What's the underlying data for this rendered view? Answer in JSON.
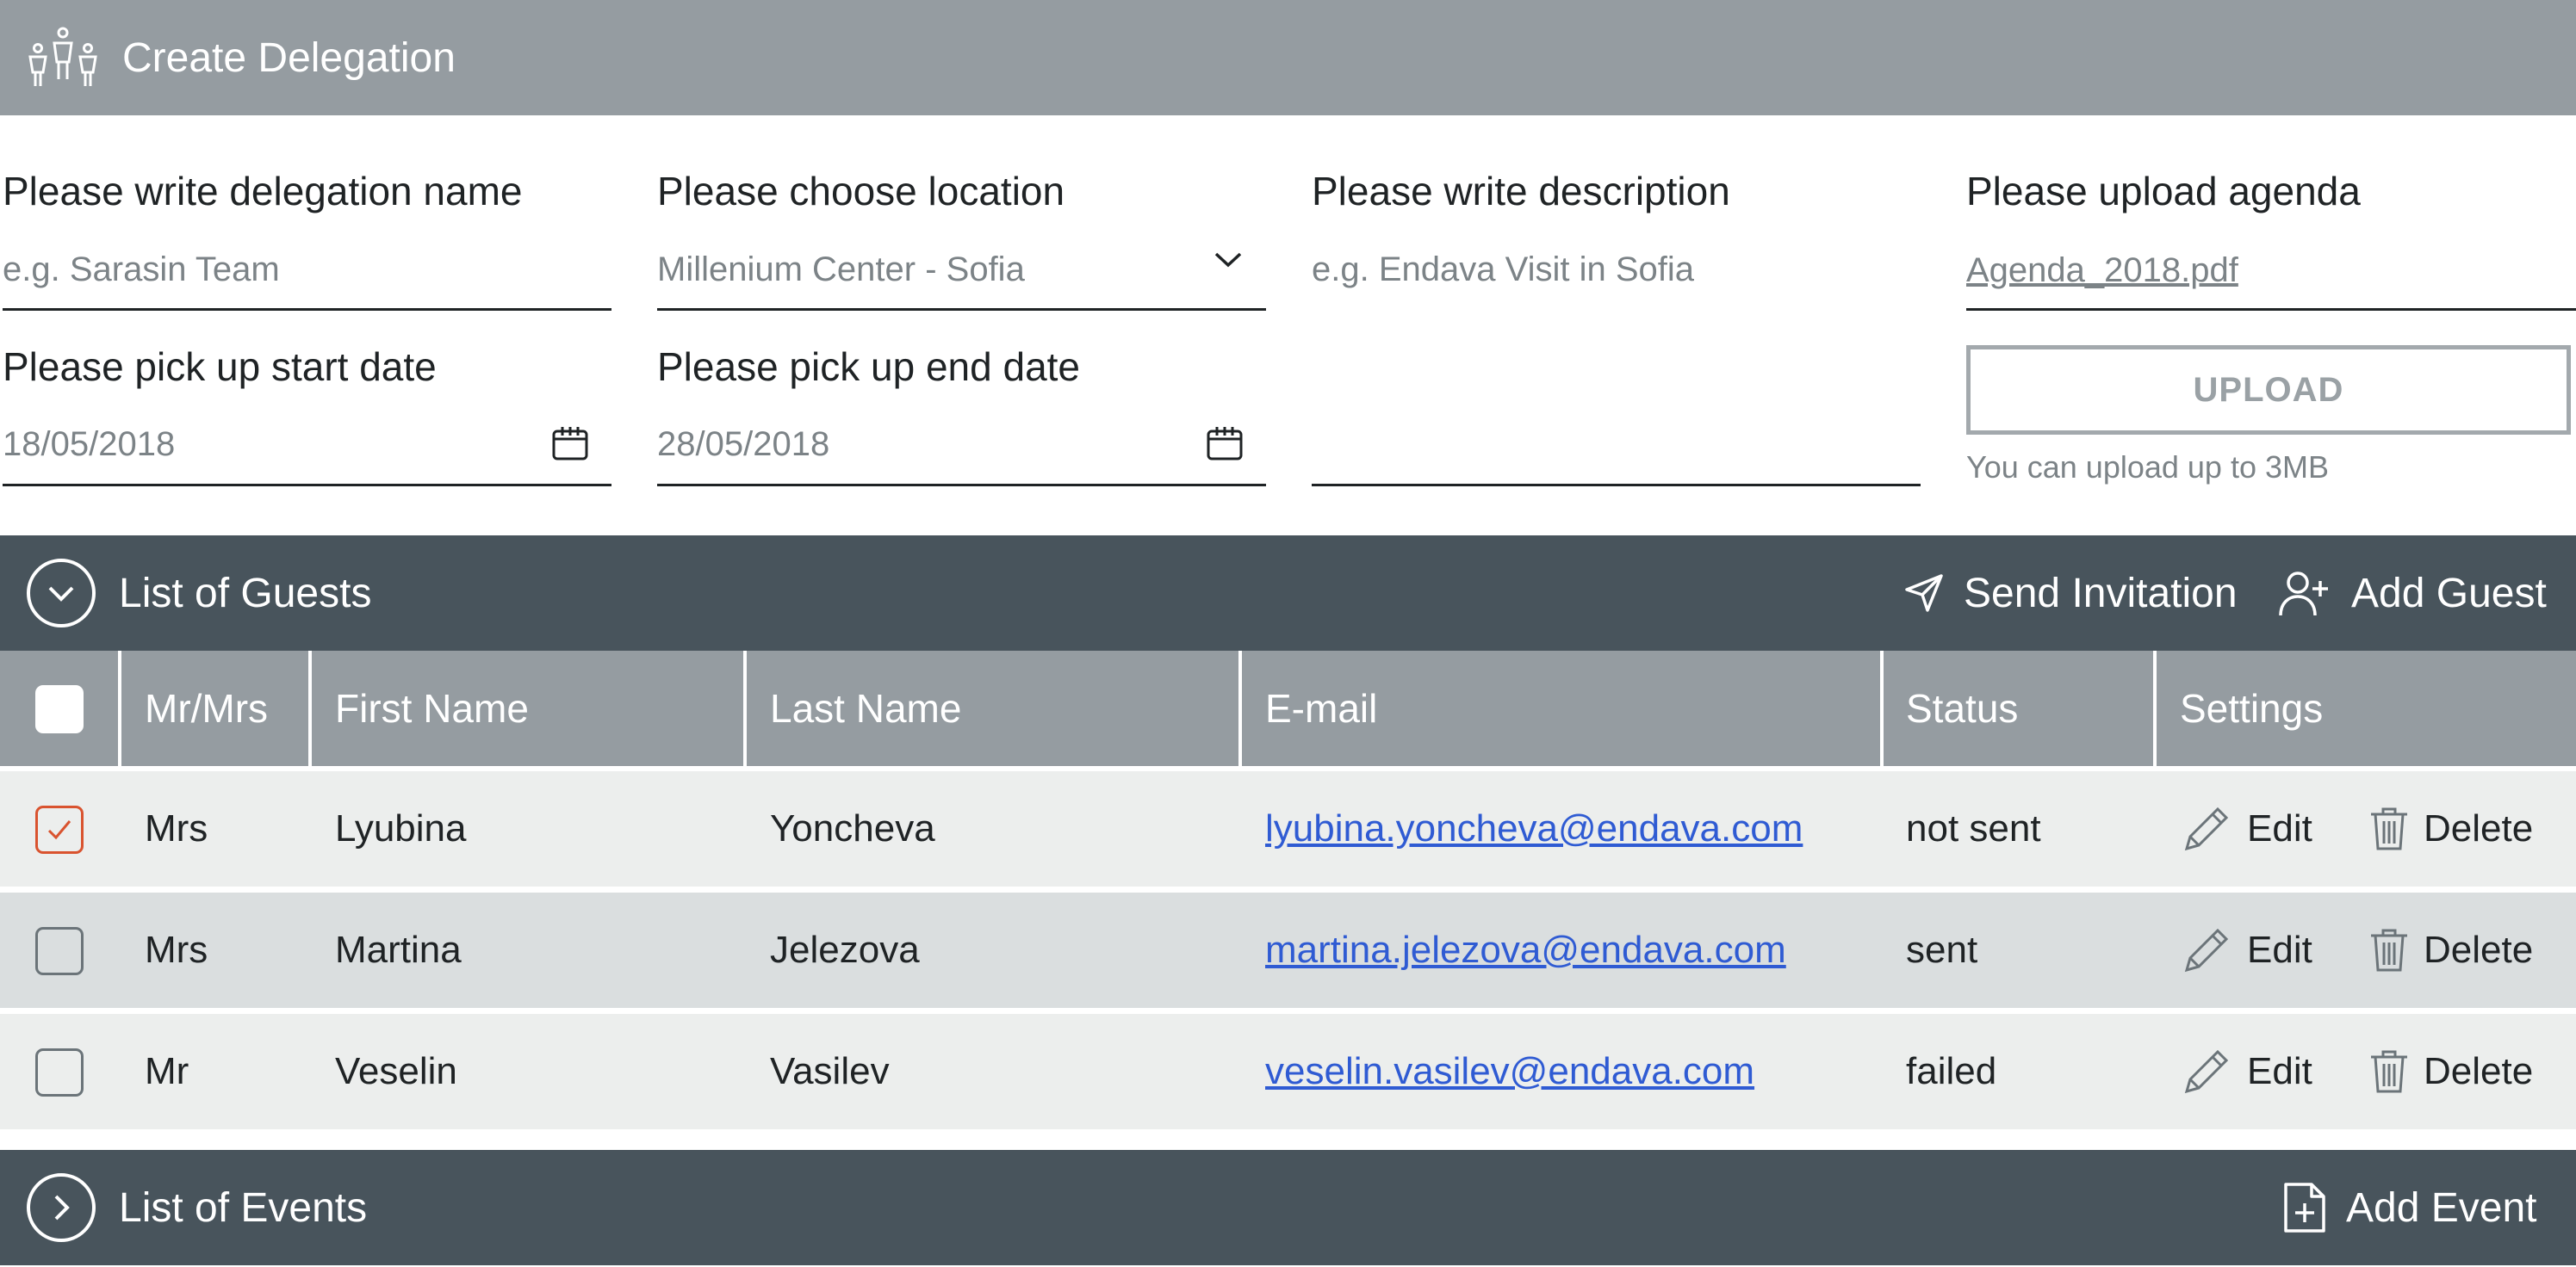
{
  "header": {
    "title": "Create Delegation",
    "icon": "delegation-people-icon"
  },
  "form": {
    "name": {
      "label": "Please write delegation name",
      "placeholder": "e.g. Sarasin Team"
    },
    "location": {
      "label": "Please choose location",
      "value": "Millenium Center - Sofia"
    },
    "description": {
      "label": "Please write description",
      "placeholder": "e.g. Endava Visit in Sofia"
    },
    "agenda": {
      "label": "Please upload agenda",
      "file": "Agenda_2018.pdf",
      "upload_label": "UPLOAD",
      "hint": "You can upload up to 3MB"
    },
    "start_date": {
      "label": "Please pick up start date",
      "value": "18/05/2018"
    },
    "end_date": {
      "label": "Please pick up end date",
      "value": "28/05/2018"
    }
  },
  "guests": {
    "title": "List of Guests",
    "send_invitation": "Send Invitation",
    "add_guest": "Add Guest",
    "columns": [
      "Mr/Mrs",
      "First Name",
      "Last Name",
      "E-mail",
      "Status",
      "Settings"
    ],
    "rows": [
      {
        "checked": true,
        "title": "Mrs",
        "first": "Lyubina",
        "last": "Yoncheva",
        "email": "lyubina.yoncheva@endava.com",
        "status": "not sent"
      },
      {
        "checked": false,
        "title": "Mrs",
        "first": "Martina",
        "last": "Jelezova",
        "email": "martina.jelezova@endava.com",
        "status": "sent"
      },
      {
        "checked": false,
        "title": "Mr",
        "first": "Veselin",
        "last": "Vasilev",
        "email": "veselin.vasilev@endava.com",
        "status": "failed"
      }
    ],
    "edit_label": "Edit",
    "delete_label": "Delete"
  },
  "events": {
    "title": "List of Events",
    "add_event": "Add Event"
  },
  "colors": {
    "header_bg": "#959ca1",
    "section_bg": "#48545c",
    "link": "#2f5bd3",
    "check_accent": "#d9532f"
  }
}
